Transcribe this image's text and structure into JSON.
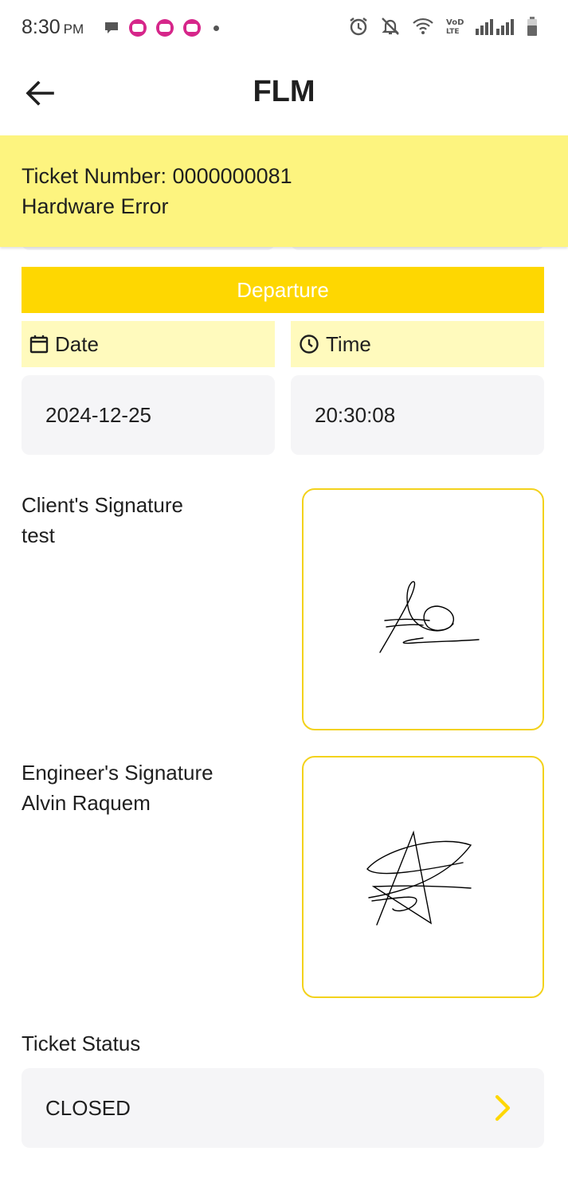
{
  "status_bar": {
    "time": "8:30",
    "ampm": "PM",
    "notification_icons": [
      "chat-bubble-icon",
      "lazada-icon",
      "lazada-icon",
      "lazada-icon",
      "more-dot-icon"
    ],
    "system_icons": [
      "alarm-icon",
      "bell-off-icon",
      "wifi-icon",
      "volte-icon",
      "signal-icon",
      "signal-icon",
      "battery-icon"
    ],
    "volte_text": "VoLTE"
  },
  "app_bar": {
    "title": "FLM",
    "back_icon": "arrow-left-icon"
  },
  "ticket": {
    "number_line": "Ticket Number: 0000000081",
    "issue": "Hardware Error"
  },
  "departure": {
    "header": "Departure",
    "date_label": "Date",
    "time_label": "Time",
    "date_value": "2024-12-25",
    "time_value": "20:30:08"
  },
  "signatures": {
    "client_title": "Client's Signature",
    "client_name": "test",
    "engineer_title": "Engineer's Signature",
    "engineer_name": "Alvin Raquem"
  },
  "ticket_status": {
    "label": "Ticket Status",
    "value": "CLOSED"
  },
  "colors": {
    "accent_yellow": "#fed701",
    "banner_yellow": "#fdf47f",
    "label_yellow": "#fffabd",
    "field_gray": "#f5f5f7",
    "signature_border": "#f3d21c"
  }
}
